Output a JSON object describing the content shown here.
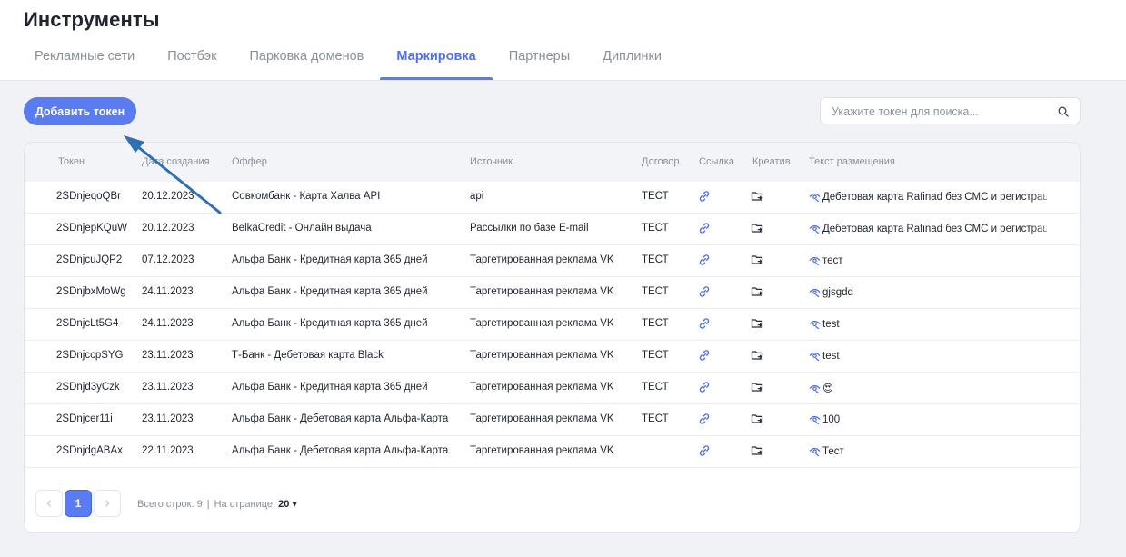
{
  "header": {
    "title": "Инструменты",
    "tabs": [
      {
        "label": "Рекламные сети",
        "active": false
      },
      {
        "label": "Постбэк",
        "active": false
      },
      {
        "label": "Парковка доменов",
        "active": false
      },
      {
        "label": "Маркировка",
        "active": true
      },
      {
        "label": "Партнеры",
        "active": false
      },
      {
        "label": "Диплинки",
        "active": false
      }
    ]
  },
  "toolbar": {
    "add_label": "Добавить токен",
    "search_placeholder": "Укажите токен для поиска...",
    "search_icon": "search-icon"
  },
  "table": {
    "columns": [
      "Токен",
      "Дата создания",
      "Оффер",
      "Источник",
      "Договор",
      "Ссылка",
      "Креатив",
      "Текст размещения"
    ],
    "rows": [
      {
        "token": "2SDnjeqoQBr",
        "date": "20.12.2023",
        "offer": "Совкомбанк - Карта Халва API",
        "source": "api",
        "contract": "ТЕСТ",
        "text": "Дебетовая карта Rafinad без СМС и регистрации"
      },
      {
        "token": "2SDnjepKQuW",
        "date": "20.12.2023",
        "offer": "BelkaCredit - Онлайн выдача",
        "source": "Рассылки по базе E-mail",
        "contract": "ТЕСТ",
        "text": "Дебетовая карта Rafinad без СМС и регистрации"
      },
      {
        "token": "2SDnjcuJQP2",
        "date": "07.12.2023",
        "offer": "Альфа Банк - Кредитная карта 365 дней",
        "source": "Таргетированная реклама VK",
        "contract": "ТЕСТ",
        "text": "тест"
      },
      {
        "token": "2SDnjbxMoWg",
        "date": "24.11.2023",
        "offer": "Альфа Банк - Кредитная карта 365 дней",
        "source": "Таргетированная реклама VK",
        "contract": "ТЕСТ",
        "text": "gjsgdd"
      },
      {
        "token": "2SDnjcLt5G4",
        "date": "24.11.2023",
        "offer": "Альфа Банк - Кредитная карта 365 дней",
        "source": "Таргетированная реклама VK",
        "contract": "ТЕСТ",
        "text": "test"
      },
      {
        "token": "2SDnjccpSYG",
        "date": "23.11.2023",
        "offer": "Т-Банк - Дебетовая карта Black",
        "source": "Таргетированная реклама VK",
        "contract": "ТЕСТ",
        "text": "test"
      },
      {
        "token": "2SDnjd3yCzk",
        "date": "23.11.2023",
        "offer": "Альфа Банк - Кредитная карта 365 дней",
        "source": "Таргетированная реклама VK",
        "contract": "ТЕСТ",
        "text": "😍"
      },
      {
        "token": "2SDnjcer11i",
        "date": "23.11.2023",
        "offer": "Альфа Банк - Дебетовая карта Альфа-Карта",
        "source": "Таргетированная реклама VK",
        "contract": "ТЕСТ",
        "text": "100"
      },
      {
        "token": "2SDnjdgABAx",
        "date": "22.11.2023",
        "offer": "Альфа Банк - Дебетовая карта Альфа-Карта",
        "source": "Таргетированная реклама VK",
        "contract": "",
        "text": "Тест"
      }
    ]
  },
  "pagination": {
    "prev_icon": "chevron-left-icon",
    "next_icon": "chevron-right-icon",
    "current_page": "1",
    "total_label": "Всего строк: 9",
    "separator": "|",
    "per_page_label": "На странице:",
    "per_page_value": "20 ▾"
  },
  "colors": {
    "accent": "#5b7cf0",
    "annotation_arrow": "#2f6fb4",
    "icon": "#4e6fe6"
  }
}
